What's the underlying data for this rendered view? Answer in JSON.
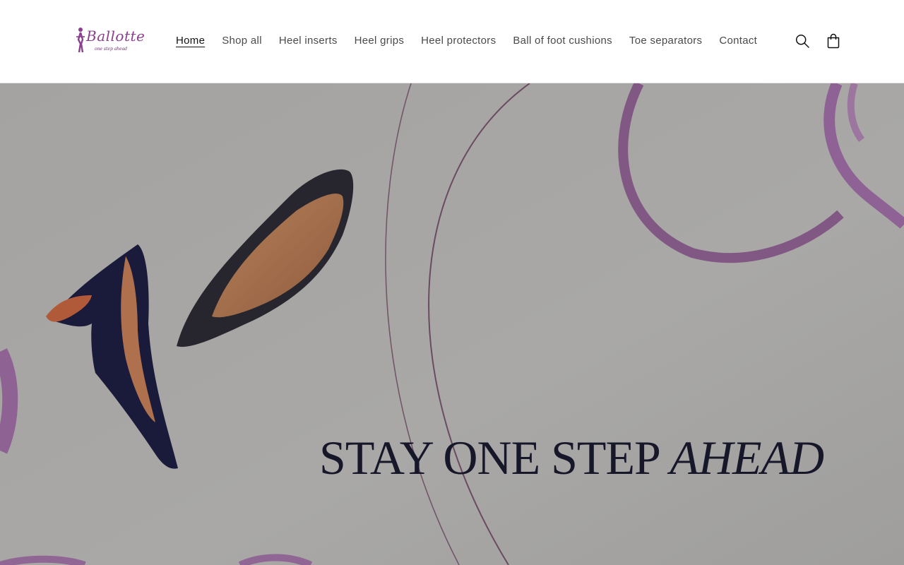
{
  "brand": {
    "name": "Ballotte",
    "tagline": "one step ahead"
  },
  "nav": {
    "items": [
      {
        "label": "Home",
        "active": true
      },
      {
        "label": "Shop all"
      },
      {
        "label": "Heel inserts"
      },
      {
        "label": "Heel grips"
      },
      {
        "label": "Heel protectors"
      },
      {
        "label": "Ball of foot cushions"
      },
      {
        "label": "Toe separators"
      },
      {
        "label": "Contact"
      }
    ]
  },
  "header_icons": {
    "search": "search-icon",
    "cart": "cart-icon"
  },
  "hero": {
    "headline_main": "STAY ONE STEP",
    "headline_emphasis": "AHEAD"
  },
  "colors": {
    "brand_purple": "#8a3f8f",
    "hero_background": "#a9a7a5",
    "headline": "#17172a",
    "ribbon": "#8a5a8e"
  }
}
